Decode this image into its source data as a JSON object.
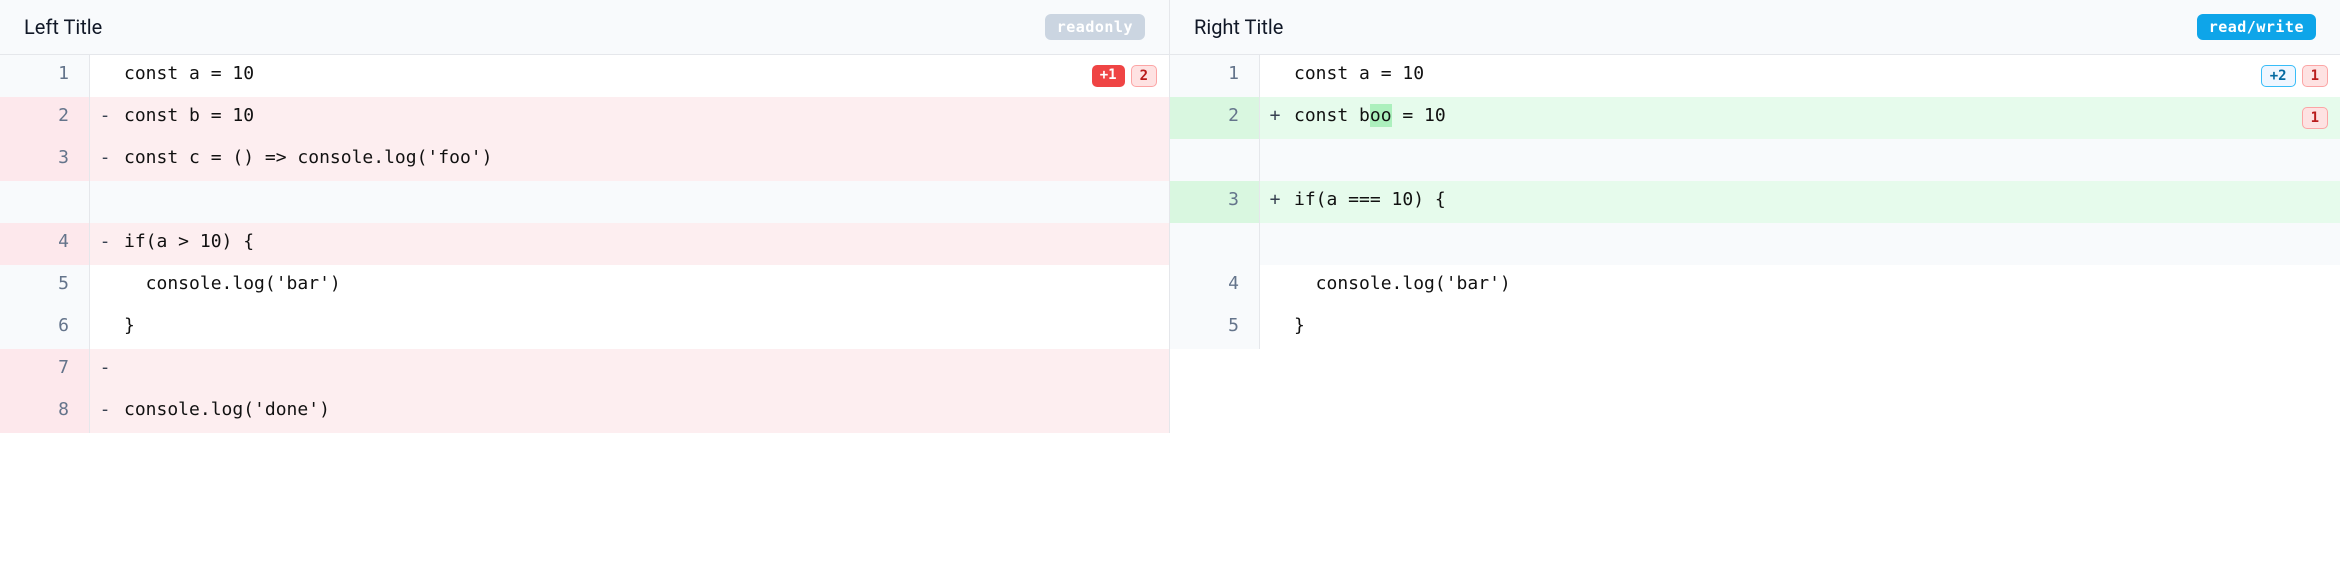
{
  "left": {
    "title": "Left Title",
    "mode_badge": "readonly",
    "lines": [
      {
        "n": "1",
        "type": "context",
        "marker": " ",
        "code": "const a = 10",
        "pills": [
          {
            "kind": "solid-red",
            "text": "+1"
          },
          {
            "kind": "outline-red",
            "text": "2"
          }
        ]
      },
      {
        "n": "2",
        "type": "removed",
        "marker": "-",
        "code": "const b = 10"
      },
      {
        "n": "3",
        "type": "removed",
        "marker": "-",
        "code": "const c = () => console.log('foo')"
      },
      {
        "n": "",
        "type": "spacer",
        "marker": " ",
        "code": ""
      },
      {
        "n": "4",
        "type": "removed",
        "marker": "-",
        "code": "if(a > 10) {"
      },
      {
        "n": "5",
        "type": "context",
        "marker": " ",
        "code": "  console.log('bar')"
      },
      {
        "n": "6",
        "type": "context",
        "marker": " ",
        "code": "}"
      },
      {
        "n": "7",
        "type": "removed",
        "marker": "-",
        "code": ""
      },
      {
        "n": "8",
        "type": "removed",
        "marker": "-",
        "code": "console.log('done')"
      }
    ]
  },
  "right": {
    "title": "Right Title",
    "mode_badge": "read/write",
    "lines": [
      {
        "n": "1",
        "type": "context",
        "marker": " ",
        "code": "const a = 10",
        "pills": [
          {
            "kind": "outline-blue",
            "text": "+2"
          },
          {
            "kind": "outline-red",
            "text": "1"
          }
        ]
      },
      {
        "n": "2",
        "type": "added",
        "marker": "+",
        "segments": [
          {
            "text": "const b"
          },
          {
            "text": "oo",
            "hl": true
          },
          {
            "text": " = 10"
          }
        ],
        "pills": [
          {
            "kind": "outline-red",
            "text": "1"
          }
        ]
      },
      {
        "n": "",
        "type": "spacer",
        "marker": " ",
        "code": ""
      },
      {
        "n": "3",
        "type": "added",
        "marker": "+",
        "code": "if(a === 10) {"
      },
      {
        "n": "",
        "type": "spacer",
        "marker": " ",
        "code": ""
      },
      {
        "n": "4",
        "type": "context",
        "marker": " ",
        "code": "  console.log('bar')"
      },
      {
        "n": "5",
        "type": "context",
        "marker": " ",
        "code": "}"
      }
    ]
  }
}
